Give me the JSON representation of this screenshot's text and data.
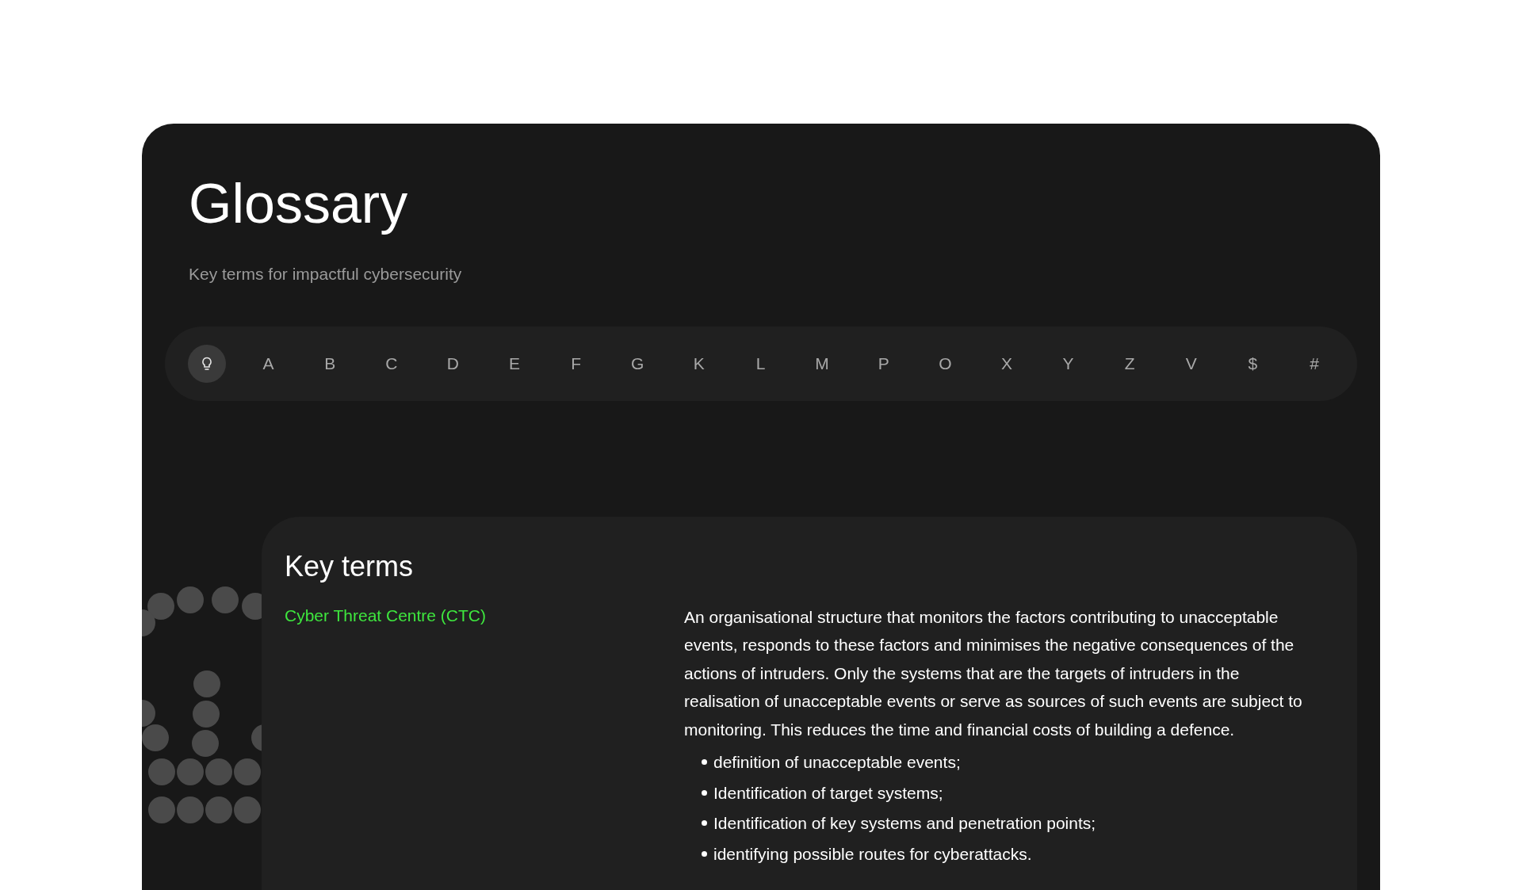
{
  "header": {
    "title": "Glossary",
    "subtitle": "Key terms for impactful cybersecurity"
  },
  "alphabet": [
    {
      "kind": "icon",
      "selected": true
    },
    {
      "kind": "letter",
      "label": "A",
      "selected": false
    },
    {
      "kind": "letter",
      "label": "B",
      "selected": false
    },
    {
      "kind": "letter",
      "label": "C",
      "selected": false
    },
    {
      "kind": "letter",
      "label": "D",
      "selected": false
    },
    {
      "kind": "letter",
      "label": "E",
      "selected": false
    },
    {
      "kind": "letter",
      "label": "F",
      "selected": false
    },
    {
      "kind": "letter",
      "label": "G",
      "selected": false
    },
    {
      "kind": "letter",
      "label": "K",
      "selected": false
    },
    {
      "kind": "letter",
      "label": "L",
      "selected": false
    },
    {
      "kind": "letter",
      "label": "M",
      "selected": false
    },
    {
      "kind": "letter",
      "label": "P",
      "selected": false
    },
    {
      "kind": "letter",
      "label": "O",
      "selected": false
    },
    {
      "kind": "letter",
      "label": "X",
      "selected": false
    },
    {
      "kind": "letter",
      "label": "Y",
      "selected": false
    },
    {
      "kind": "letter",
      "label": "Z",
      "selected": false
    },
    {
      "kind": "letter",
      "label": "V",
      "selected": false
    },
    {
      "kind": "letter",
      "label": "$",
      "selected": false
    },
    {
      "kind": "letter",
      "label": "#",
      "selected": false
    }
  ],
  "section": {
    "title": "Key terms",
    "entries": [
      {
        "term": "Cyber Threat Centre (CTC)",
        "definition": "An organisational structure that monitors the factors contributing to unacceptable events, responds to these factors and minimises the negative consequences of the actions of intruders. Only the systems that are the targets of intruders in the realisation of unacceptable events or serve as sources of such events are subject to monitoring. This reduces the time and financial costs of building a defence.",
        "bullets": [
          "definition of unacceptable events;",
          "Identification of target systems;",
          "Identification of key systems and penetration points;",
          "identifying possible routes for cyberattacks."
        ]
      }
    ]
  }
}
